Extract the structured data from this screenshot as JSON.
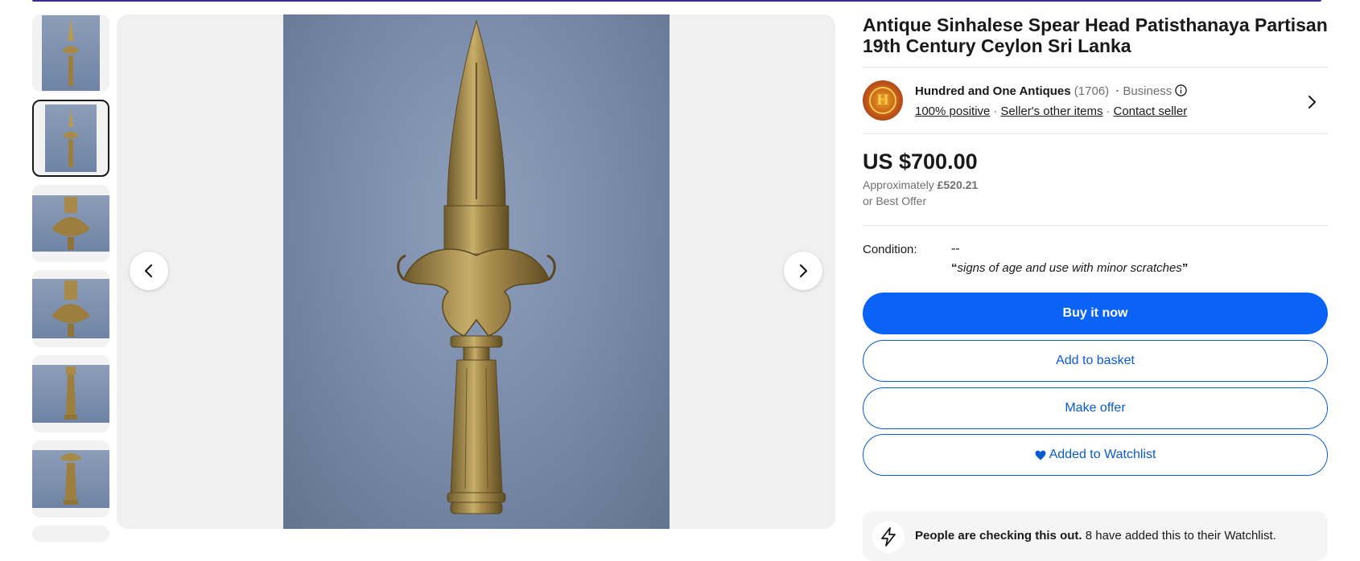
{
  "gallery": {
    "thumbnails": [
      {
        "alt": "spear-head-full"
      },
      {
        "alt": "spear-head-full-selected"
      },
      {
        "alt": "spear-head-detail-top"
      },
      {
        "alt": "spear-head-detail-mid"
      },
      {
        "alt": "spear-head-socket"
      },
      {
        "alt": "spear-head-socket-2"
      }
    ],
    "prev_icon": "chevron-left-icon",
    "next_icon": "chevron-right-icon"
  },
  "listing": {
    "title": "Antique Sinhalese Spear Head Patisthanaya Partisan 19th Century Ceylon Sri Lanka"
  },
  "seller": {
    "avatar_letter": "H",
    "name": "Hundred and One Antiques",
    "feedback_count": "(1706)",
    "type": "Business",
    "positive": "100% positive",
    "other_items": "Seller's other items",
    "contact": "Contact seller"
  },
  "price": {
    "main": "US $700.00",
    "approx_label": "Approximately",
    "approx_value": "£520.21",
    "best_offer": "or Best Offer"
  },
  "condition": {
    "label": "Condition:",
    "value": "--",
    "quote": "signs of age and use with minor scratches"
  },
  "buttons": {
    "buy_now": "Buy it now",
    "add_basket": "Add to basket",
    "make_offer": "Make offer",
    "watchlist": "Added to Watchlist"
  },
  "alert": {
    "strong": "People are checking this out.",
    "text": "8 have added this to their Watchlist."
  },
  "colors": {
    "primary_blue": "#0a63f6",
    "link_blue": "#0a5ad3",
    "top_bar": "#3d2b9a"
  }
}
